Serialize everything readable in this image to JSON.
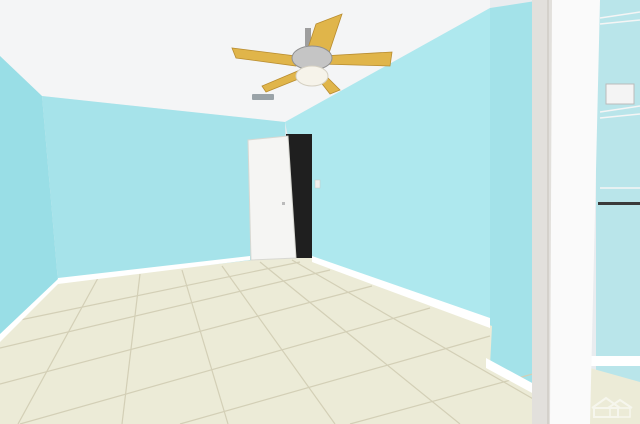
{
  "scene": {
    "kind": "photograph",
    "subject": "empty room",
    "wall_color": "#a9e6ec",
    "wall_shade_color": "#8fd6e0",
    "ceiling_color": "#f3f4f5",
    "floor_color": "#ecebd9",
    "grout_color": "#cfcbb3",
    "baseboard_color": "#ffffff",
    "door_color": "#f7f7f5",
    "fan_blade_color": "#e0b54a",
    "fan_motor_color": "#bdbdbd"
  },
  "objects": {
    "ceiling_fan": "ceiling-fan",
    "interior_door": "interior-door",
    "closet_door": "closet-bifold-door",
    "closet_shelves": "wire-shelves",
    "light_switch": "light-switch",
    "air_vent": "ceiling-vent"
  },
  "watermark": {
    "icon": "house-logo-icon"
  }
}
